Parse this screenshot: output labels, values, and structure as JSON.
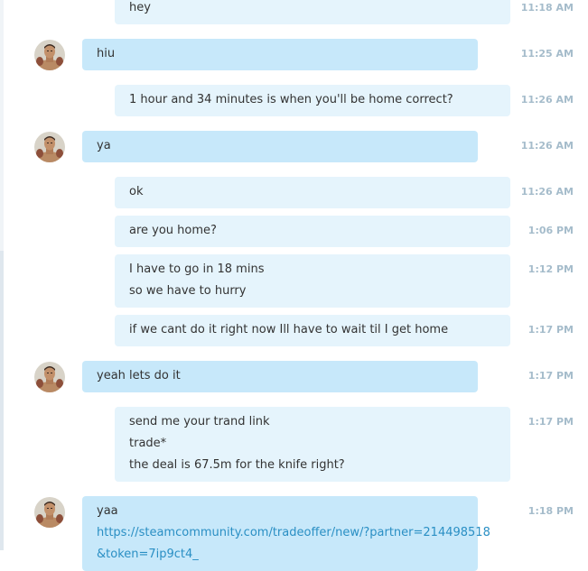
{
  "colors": {
    "incoming_bubble": "#c7e8fa",
    "outgoing_bubble": "#e5f4fc",
    "timestamp": "#a5bccb",
    "link": "#2a8fc4"
  },
  "avatar_icon": "contact-avatar-photo",
  "messages": [
    {
      "dir": "out",
      "time": "11:18 AM",
      "lines": [
        "hey"
      ]
    },
    {
      "dir": "in",
      "time": "11:25 AM",
      "lines": [
        "hiu"
      ]
    },
    {
      "dir": "out",
      "time": "11:26 AM",
      "lines": [
        "1 hour and 34 minutes is when you'll be home correct?"
      ]
    },
    {
      "dir": "in",
      "time": "11:26 AM",
      "lines": [
        "ya"
      ]
    },
    {
      "dir": "out",
      "time": "11:26 AM",
      "lines": [
        "ok"
      ]
    },
    {
      "dir": "out",
      "time": "1:06 PM",
      "lines": [
        "are you home?"
      ]
    },
    {
      "dir": "out",
      "time": "1:12 PM",
      "lines": [
        "I have to go in 18 mins",
        "so we have to hurry"
      ]
    },
    {
      "dir": "out",
      "time": "1:17 PM",
      "lines": [
        "if we cant do it right now Ill have to wait til I get home"
      ]
    },
    {
      "dir": "in",
      "time": "1:17 PM",
      "lines": [
        "yeah lets do it"
      ]
    },
    {
      "dir": "out",
      "time": "1:17 PM",
      "lines": [
        "send me your trand link",
        "trade*",
        "the deal is 67.5m for the knife right?"
      ]
    },
    {
      "dir": "in",
      "time": "1:18 PM",
      "lines": [
        "yaa",
        "https://steamcommunity.com/tradeoffer/new/?partner=214498518",
        "&token=7ip9ct4_"
      ],
      "link_lines": [
        1,
        2
      ]
    }
  ]
}
